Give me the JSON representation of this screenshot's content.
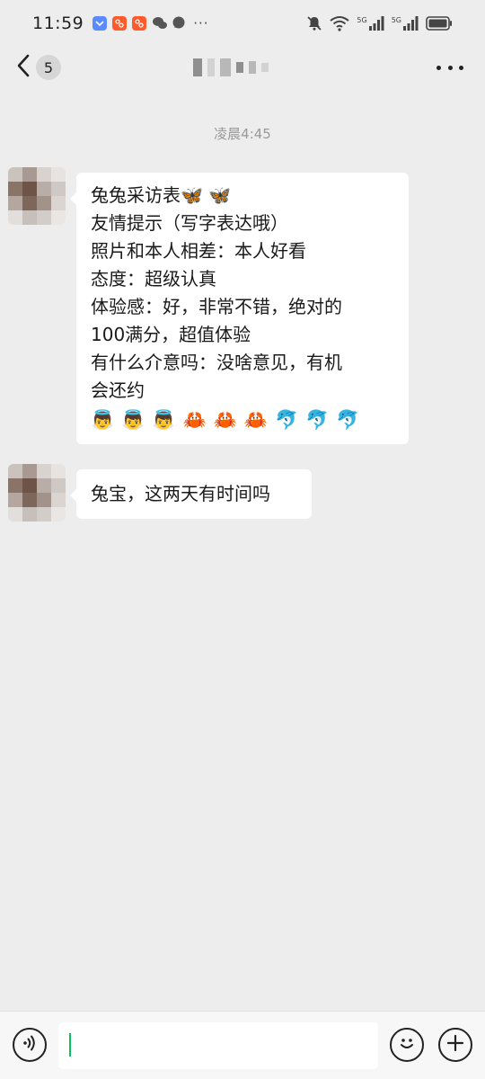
{
  "status_bar": {
    "time": "11:59",
    "more": "···",
    "network_1": "5G",
    "network_2": "5G",
    "icons": [
      "app-blue-icon",
      "app-orange-icon",
      "app-orange-icon",
      "wechat-icon",
      "chat-icon",
      "mute-icon",
      "wifi-icon",
      "signal-icon",
      "signal-icon",
      "battery-icon"
    ]
  },
  "header": {
    "back_icon": "chevron-left-icon",
    "unread_count": "5",
    "contact_name": "",
    "more_icon": "more-dots-icon"
  },
  "chat": {
    "timestamp": "凌晨4:45",
    "messages": [
      {
        "lines": [
          "兔兔采访表🦋 🦋",
          "友情提示（写字表达哦）",
          "照片和本人相差：本人好看",
          "态度：超级认真",
          "体验感：好，非常不错，绝对的",
          "100满分，超值体验",
          "有什么介意吗：没啥意见，有机",
          "会还约"
        ],
        "emojis": [
          "👼",
          "👼",
          "👼",
          "🦀",
          "🦀",
          "🦀",
          "🐬",
          "🐬",
          "🐬"
        ]
      },
      {
        "lines": [
          "兔宝，这两天有时间吗"
        ]
      }
    ]
  },
  "input_bar": {
    "voice_icon": "voice-icon",
    "input_value": "",
    "emoji_icon": "smile-icon",
    "plus_icon": "plus-icon"
  },
  "colors": {
    "background": "#ededed",
    "bubble": "#ffffff",
    "accent": "#07c160"
  }
}
